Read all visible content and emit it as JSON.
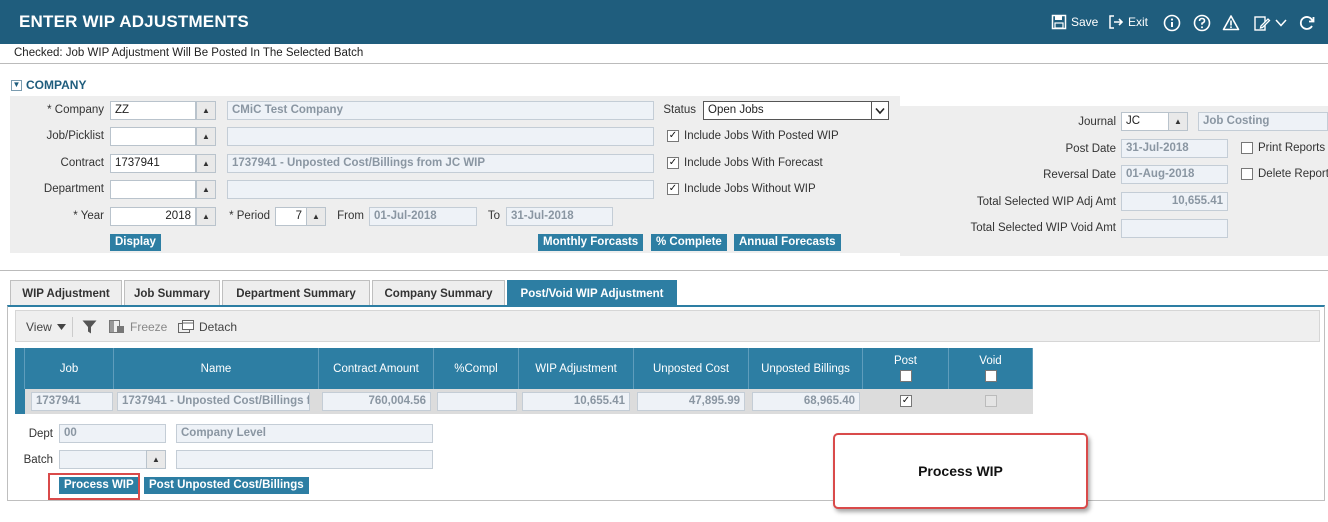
{
  "title": "ENTER WIP ADJUSTMENTS",
  "toolbar_top": {
    "save": "Save",
    "exit": "Exit"
  },
  "info_message": "Checked: Job WIP Adjustment Will Be Posted In The Selected Batch",
  "section": {
    "title": "COMPANY"
  },
  "form": {
    "company_label": "* Company",
    "company_value": "ZZ",
    "company_name": "CMiC Test Company",
    "job_label": "Job/Picklist",
    "job_value": "",
    "contract_label": "Contract",
    "contract_value": "1737941",
    "contract_desc": "1737941 - Unposted Cost/Billings from JC WIP",
    "department_label": "Department",
    "department_value": "",
    "year_label": "* Year",
    "year_value": "2018",
    "period_label": "* Period",
    "period_value": "7",
    "from_label": "From",
    "from_value": "01-Jul-2018",
    "to_label": "To",
    "to_value": "31-Jul-2018",
    "display_btn": "Display",
    "status_label": "Status",
    "status_value": "Open Jobs",
    "chk_posted_wip": "Include Jobs With Posted WIP",
    "chk_forecast": "Include Jobs With Forecast",
    "chk_without_wip": "Include Jobs Without WIP",
    "btn_monthly": "Monthly Forcasts",
    "btn_complete": "% Complete",
    "btn_annual": "Annual Forecasts"
  },
  "right_form": {
    "journal_label": "Journal",
    "journal_value": "JC",
    "journal_name": "Job Costing",
    "post_date_label": "Post Date",
    "post_date_value": "31-Jul-2018",
    "reversal_label": "Reversal Date",
    "reversal_value": "01-Aug-2018",
    "total_adj_label": "Total Selected WIP Adj Amt",
    "total_adj_value": "10,655.41",
    "total_void_label": "Total Selected WIP Void Amt",
    "total_void_value": "",
    "print_reports": "Print Reports",
    "delete_reports": "Delete Report"
  },
  "tabs": [
    {
      "label": "WIP Adjustment"
    },
    {
      "label": "Job Summary"
    },
    {
      "label": "Department Summary"
    },
    {
      "label": "Company Summary"
    },
    {
      "label": "Post/Void WIP Adjustment"
    }
  ],
  "grid_toolbar": {
    "view": "View",
    "freeze": "Freeze",
    "detach": "Detach"
  },
  "grid": {
    "headers": [
      "Job",
      "Name",
      "Contract Amount",
      "%Compl",
      "WIP Adjustment",
      "Unposted Cost",
      "Unposted Billings",
      "Post",
      "Void"
    ],
    "row": {
      "job": "1737941",
      "name": "1737941 - Unposted Cost/Billings fr",
      "contract_amount": "760,004.56",
      "pct_compl": "",
      "wip_adjustment": "10,655.41",
      "unposted_cost": "47,895.99",
      "unposted_billings": "68,965.40",
      "post_checked": "✓"
    }
  },
  "footer": {
    "dept_label": "Dept",
    "dept_value": "00",
    "dept_name": "Company Level",
    "batch_label": "Batch",
    "batch_value": "",
    "batch_desc": "",
    "btn_process": "Process WIP",
    "btn_post_unposted": "Post Unposted Cost/Billings"
  },
  "callout": {
    "text": "Process WIP"
  }
}
